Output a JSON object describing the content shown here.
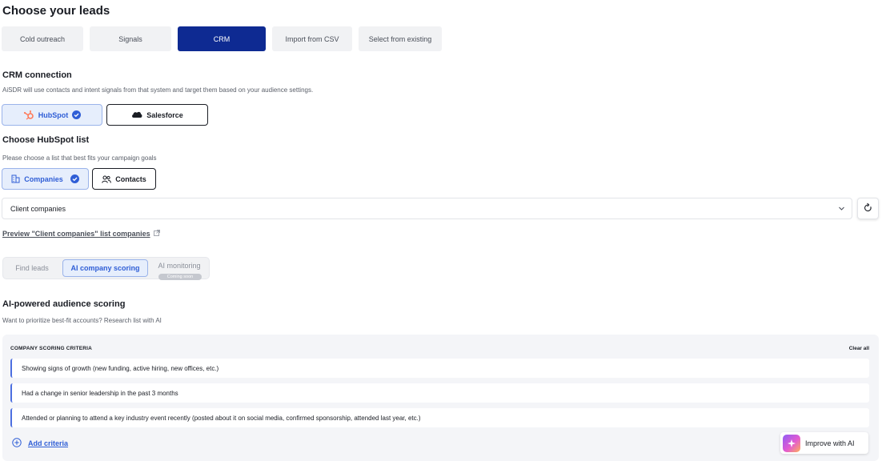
{
  "page": {
    "title": "Choose your leads"
  },
  "source_tabs": [
    {
      "label": "Cold outreach",
      "active": false
    },
    {
      "label": "Signals",
      "active": false
    },
    {
      "label": "CRM",
      "active": true
    },
    {
      "label": "Import from CSV",
      "active": false
    },
    {
      "label": "Select from existing",
      "active": false
    }
  ],
  "crm": {
    "heading": "CRM connection",
    "description": "AiSDR will use contacts and intent signals from that system and target them based on your audience settings.",
    "providers": [
      {
        "label": "HubSpot",
        "selected": true,
        "icon": "hubspot-icon"
      },
      {
        "label": "Salesforce",
        "selected": false,
        "icon": "salesforce-icon"
      }
    ]
  },
  "hubspot_list": {
    "heading": "Choose HubSpot list",
    "description": "Please choose a list that best fits your campaign goals",
    "types": [
      {
        "label": "Companies",
        "selected": true,
        "icon": "building-icon"
      },
      {
        "label": "Contacts",
        "selected": false,
        "icon": "people-icon"
      }
    ],
    "selected_list": "Client companies",
    "preview_link": "Preview \"Client companies\" list companies"
  },
  "mode_tabs": [
    {
      "label": "Find leads",
      "active": false
    },
    {
      "label": "AI company scoring",
      "active": true
    },
    {
      "label": "AI monitoring",
      "active": false,
      "badge": "Coming soon"
    }
  ],
  "scoring": {
    "heading": "AI-powered audience scoring",
    "description": "Want to prioritize best-fit accounts? Research list with AI",
    "panel_label": "COMPANY SCORING CRITERIA",
    "clear_all": "Clear all",
    "criteria": [
      "Showing signs of growth (new funding, active hiring, new offices, etc.)",
      "Had a change in senior leadership in the past 3 months",
      "Attended or planning to attend a key industry event recently (posted about it on social media, confirmed sponsorship, attended last year, etc.)"
    ],
    "add_criteria": "Add criteria",
    "improve_button": "Improve with AI"
  },
  "colors": {
    "primary_dark": "#0e2a92",
    "accent_blue": "#2f5ed6",
    "selected_bg": "#e6eefc",
    "hubspot_orange": "#ff7a59"
  }
}
